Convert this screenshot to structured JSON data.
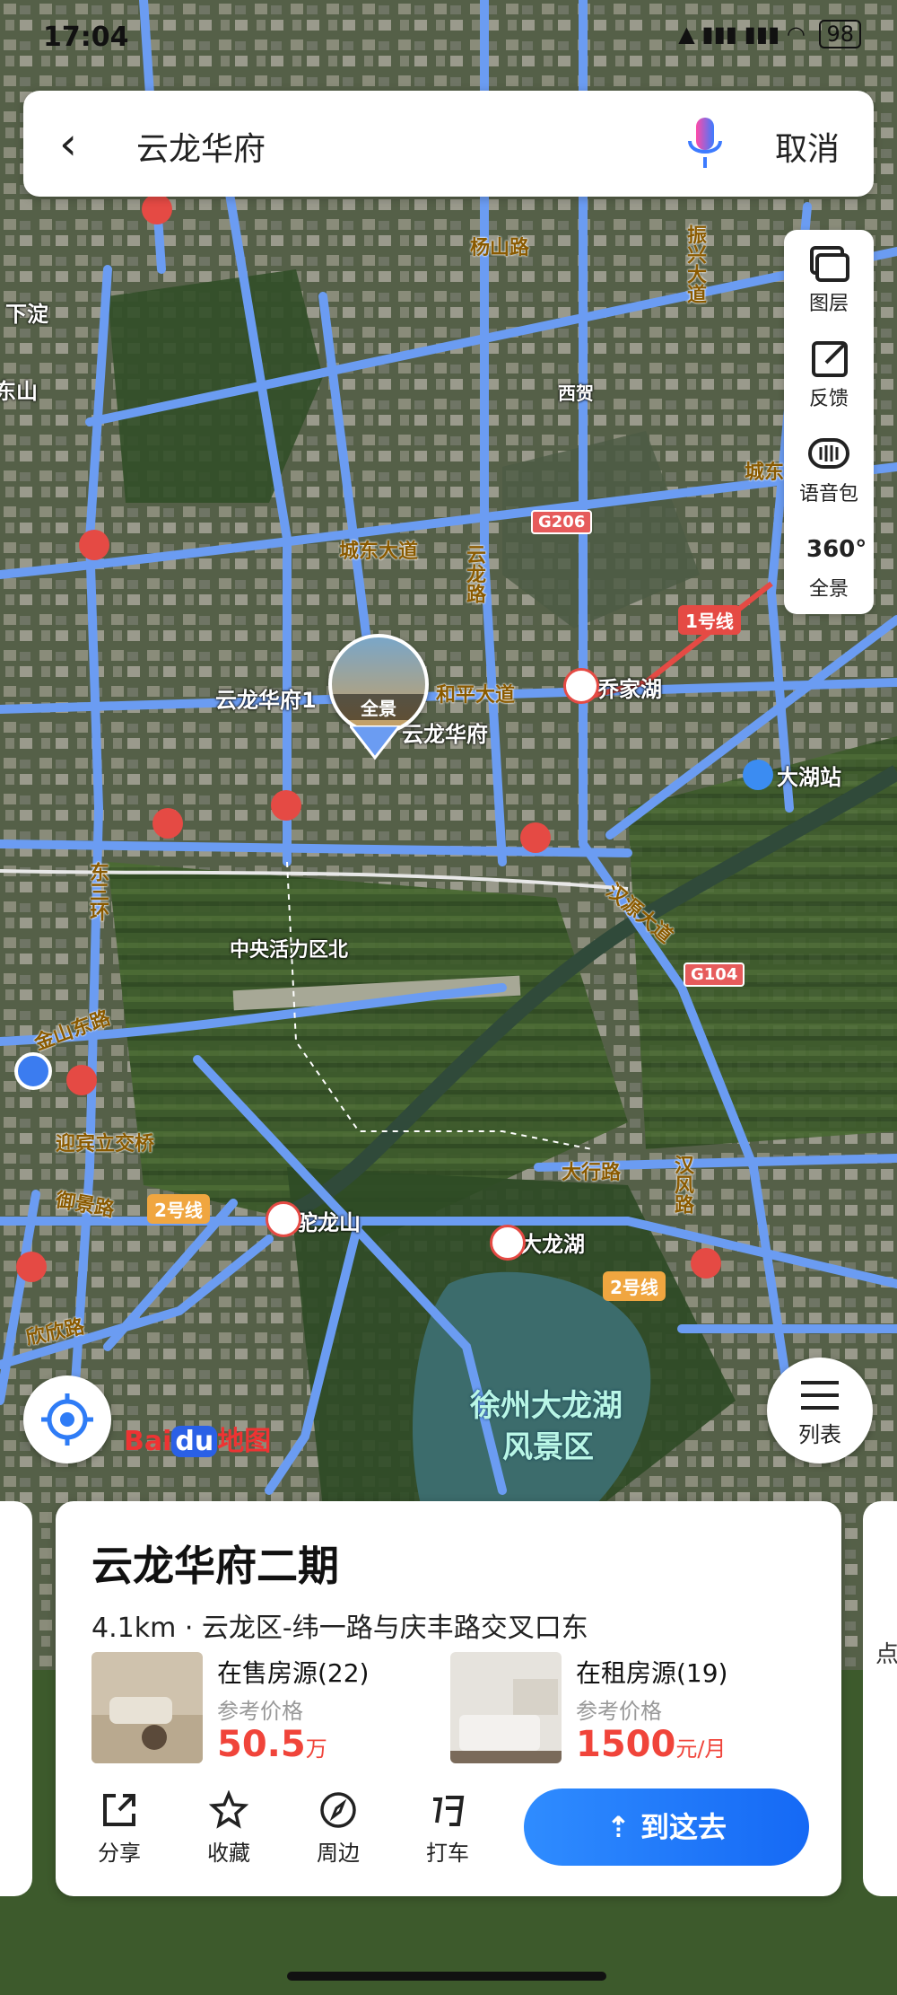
{
  "status_bar": {
    "time": "17:04",
    "battery": "98"
  },
  "search": {
    "query": "云龙华府",
    "cancel_label": "取消"
  },
  "tools": [
    {
      "icon": "layers-icon",
      "label": "图层"
    },
    {
      "icon": "feedback-icon",
      "label": "反馈"
    },
    {
      "icon": "voice-pack-icon",
      "label": "语音包"
    },
    {
      "icon": "panorama-360-icon",
      "label": "全景",
      "badge": "360°"
    }
  ],
  "map_labels": {
    "xiadian": "下淀",
    "shan": "东山",
    "yangshan_road": "杨山路",
    "zhenxing_avenue": "振兴大道",
    "xihe": "西贺",
    "chengdong_avenue": "城东大道",
    "yunlong_road": "云龙路",
    "g206": "G206",
    "line1": "1号线",
    "qiaojiahu": "乔家湖",
    "heping_avenue": "和平大道",
    "yunlonghuafu_road": "云龙华府1",
    "yunlonghuafu": "云龙华府",
    "panorama": "全景",
    "dahu_station": "大湖站",
    "dongsanhuan": "东三环",
    "hanyuan_avenue": "汉源大道",
    "zhongyang_north": "中央活力区北",
    "g104": "G104",
    "jinshan_east_road": "金山东路",
    "yingbin_interchange": "迎宾立交桥",
    "yujing_road": "御景路",
    "line2": "2号线",
    "tuolongshan": "驼龙山",
    "dalonghu": "大龙湖",
    "daxing_road": "大行路",
    "hanfeng_road": "汉风路",
    "line2b": "2号线",
    "xinxin_road": "欣欣路",
    "lake_name_1": "徐州大龙湖",
    "lake_name_2": "风景区",
    "chengyang": "城东"
  },
  "buttons": {
    "list_label": "列表"
  },
  "brand": {
    "bai": "Bai",
    "du": "du",
    "map": "地图"
  },
  "card": {
    "title": "云龙华府二期",
    "address": "4.1km · 云龙区-纬一路与庆丰路交叉口东",
    "sale": {
      "name": "在售房源(22)",
      "ref": "参考价格",
      "price": "50.5",
      "unit": "万"
    },
    "rent": {
      "name": "在租房源(19)",
      "ref": "参考价格",
      "price": "1500",
      "unit": "元/月"
    },
    "actions": [
      {
        "icon": "share-icon",
        "label": "分享"
      },
      {
        "icon": "star-icon",
        "label": "收藏"
      },
      {
        "icon": "compass-icon",
        "label": "周边"
      },
      {
        "icon": "taxi-icon",
        "label": "打车"
      }
    ],
    "go_label": "到这去",
    "side_peek": "点"
  },
  "colors": {
    "accent": "#1569f5",
    "price": "#f0443a",
    "road": "#6b9cf2"
  }
}
